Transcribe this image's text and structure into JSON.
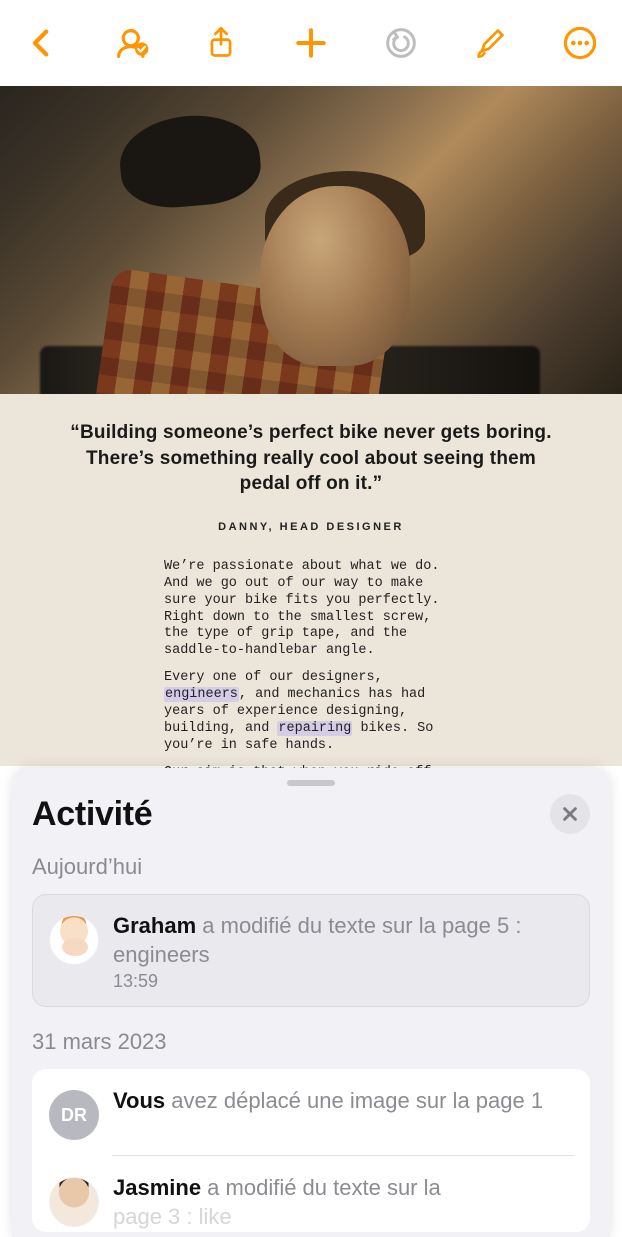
{
  "toolbar": {
    "back": "back",
    "collab": "collaboration",
    "share": "share",
    "add": "add",
    "undo": "undo",
    "format": "format-brush",
    "more": "more"
  },
  "document": {
    "quote": "“Building someone’s perfect bike never gets boring. There’s something really cool about seeing them pedal off on it.”",
    "attribution": "DANNY, HEAD DESIGNER",
    "p1a": "We’re passionate about what we do. And we go out of our way to make sure your bike fits you perfectly. Right down to the smallest screw, the type of grip tape, and the saddle-to-handlebar angle.",
    "p2a": "Every one of our designers, ",
    "p2_hl1": "engineers",
    "p2b": ", and mechanics has had years of experience designing, building, and ",
    "p2_hl2": "repairing",
    "p2c": " bikes. So you’re in safe hands.",
    "p3": "Our aim is that when you ride off from our workshop, you’ll feel like you’ve known this bike all your life."
  },
  "panel": {
    "title": "Activité",
    "section_today": "Aujourd’hui",
    "section_date": "31 mars 2023",
    "items": [
      {
        "who": "Graham",
        "rest": " a modifié du texte sur la page 5 : engineers",
        "time": "13:59",
        "avatar_initials": ""
      },
      {
        "who": "Vous",
        "rest": " avez déplacé une image sur la page 1",
        "time": "",
        "avatar_initials": "DR"
      },
      {
        "who": "Jasmine",
        "rest": " a modifié du texte sur la",
        "time": "",
        "avatar_initials": ""
      }
    ],
    "item3_cutoff": "page 3 : like"
  }
}
